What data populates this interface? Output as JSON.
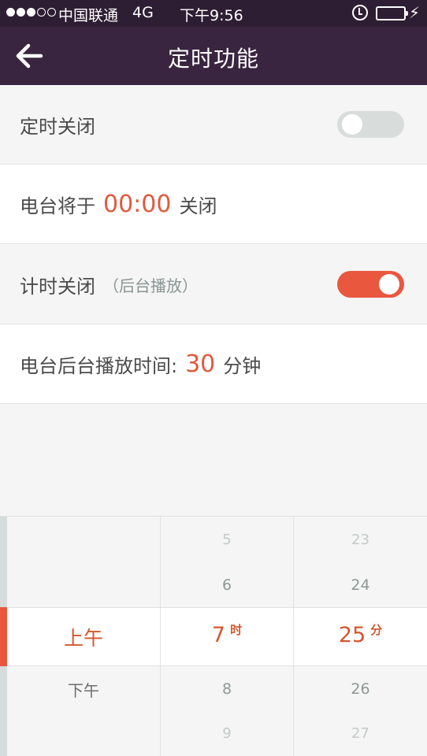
{
  "status_bar": {
    "carrier": "中国联通",
    "network": "4G",
    "time": "下午9:56",
    "signal_bars_filled": 3,
    "signal_bars_total": 5,
    "battery_color": "#5fe04d"
  },
  "nav": {
    "title": "定时功能",
    "back_icon": "arrow-left-icon"
  },
  "timer_close": {
    "label": "定时关闭",
    "enabled": false
  },
  "close_info": {
    "prefix": "电台将于",
    "time": "00:00",
    "suffix": "关闭"
  },
  "countdown_close": {
    "label": "计时关闭",
    "sub_label": "（后台播放）",
    "enabled": true
  },
  "background_play": {
    "prefix": "电台后台播放时间:",
    "minutes": "30",
    "suffix": "分钟"
  },
  "picker": {
    "ampm": {
      "selected": "上午",
      "next": "下午"
    },
    "hour": {
      "prev2": "5",
      "prev1": "6",
      "selected": "7",
      "unit": "时",
      "next1": "8",
      "next2": "9"
    },
    "minute": {
      "prev2": "23",
      "prev1": "24",
      "selected": "25",
      "unit": "分",
      "next1": "26",
      "next2": "27"
    }
  },
  "colors": {
    "nav_bg": "#3a2540",
    "accent": "#e9573f",
    "toggle_off": "#d8dddc"
  }
}
